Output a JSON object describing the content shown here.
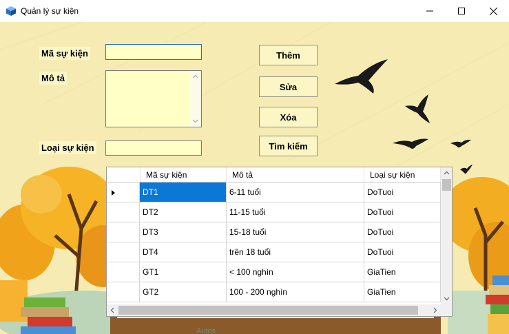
{
  "window": {
    "title": "Quản lý sự kiện"
  },
  "form": {
    "ma_label": "Mã sự kiện",
    "mota_label": "Mô tả",
    "loai_label": "Loại sự kiện",
    "ma_value": "",
    "mota_value": "",
    "loai_value": ""
  },
  "buttons": {
    "them": "Thêm",
    "sua": "Sửa",
    "xoa": "Xóa",
    "timkiem": "Tìm kiếm"
  },
  "grid": {
    "columns": [
      "Mã sự kiện",
      "Mô tả",
      "Loại sự kiện"
    ],
    "rows": [
      [
        "DT1",
        "6-11 tuổi",
        "DoTuoi"
      ],
      [
        "DT2",
        "11-15 tuổi",
        "DoTuoi"
      ],
      [
        "DT3",
        "15-18 tuổi",
        "DoTuoi"
      ],
      [
        "DT4",
        "trên 18 tuổi",
        "DoTuoi"
      ],
      [
        "GT1",
        "< 100 nghìn",
        "GiaTien"
      ],
      [
        "GT2",
        "100 - 200 nghìn",
        "GiaTien"
      ]
    ],
    "selected_row": 0
  },
  "colors": {
    "selection": "#0a78d7",
    "input_bg": "#ffffc6",
    "background": "#f6ecb3"
  }
}
